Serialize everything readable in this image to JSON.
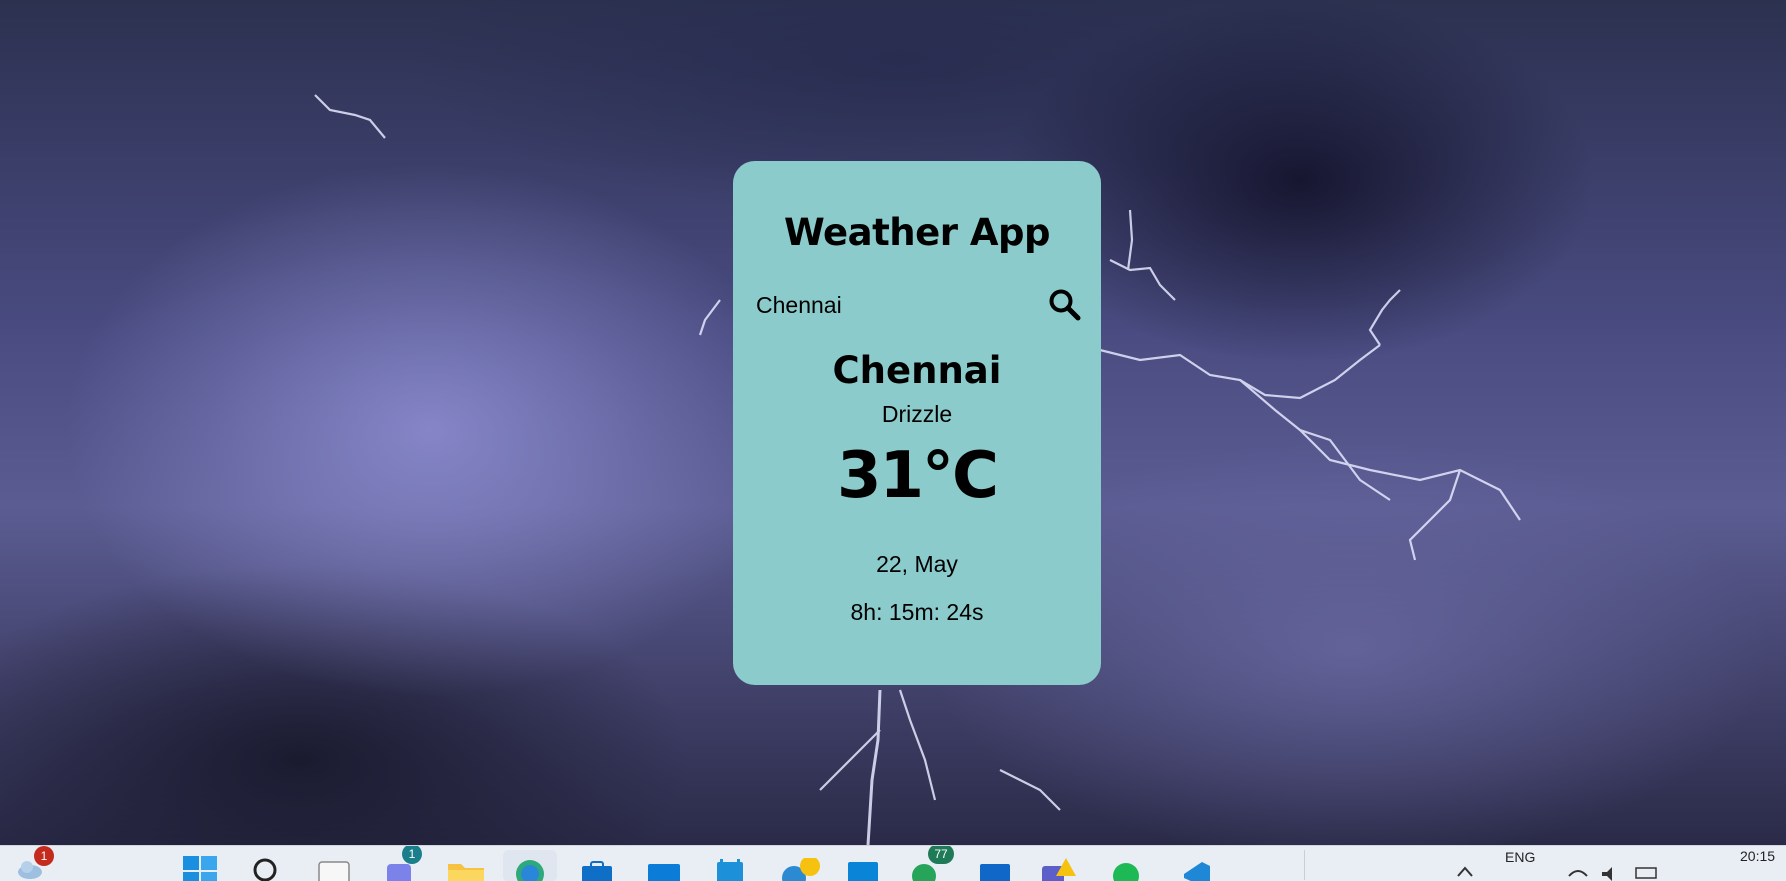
{
  "app": {
    "title": "Weather App",
    "search_value": "Chennai",
    "city": "Chennai",
    "condition": "Drizzle",
    "temperature": "31°C",
    "date": "22, May",
    "time": "8h: 15m: 24s"
  },
  "colors": {
    "card_background": "#8ccbcb",
    "text": "#000000",
    "taskbar": "#e9eef5"
  },
  "taskbar": {
    "weather_badge": "1",
    "teams_badge": "1",
    "whatsapp_badge": "77",
    "language": "ENG",
    "clock": "20:15"
  }
}
